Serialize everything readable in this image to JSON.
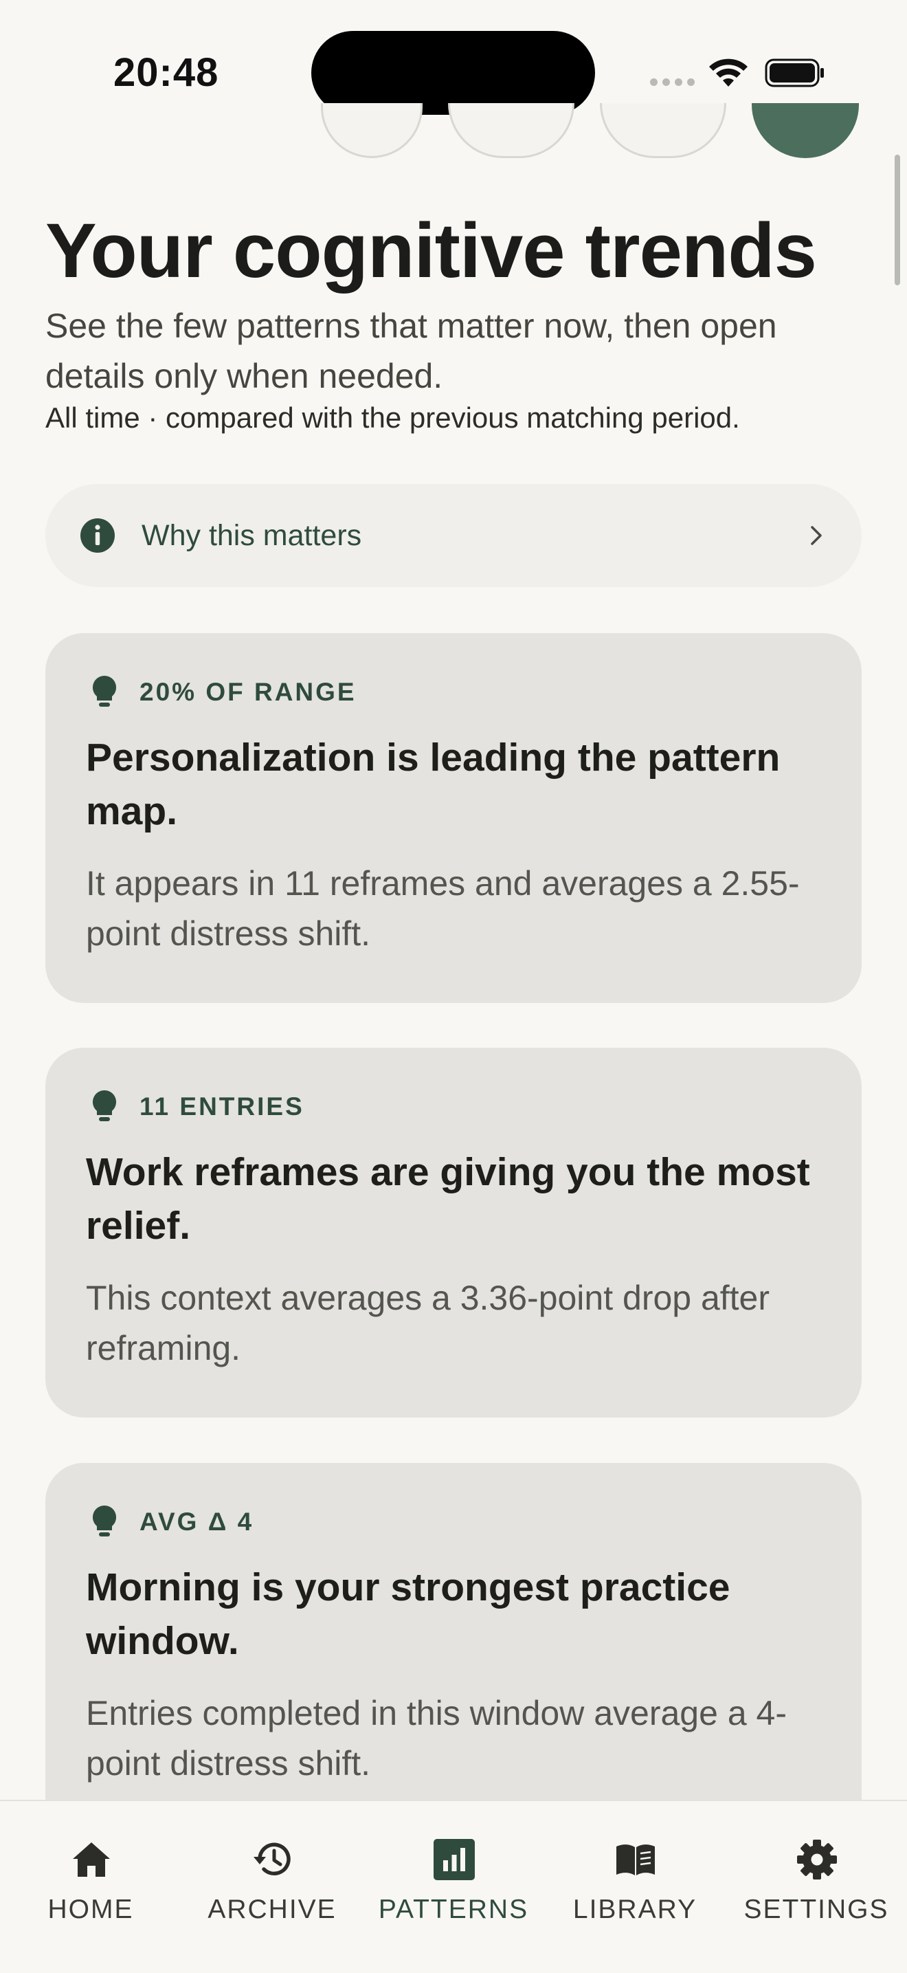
{
  "status_bar": {
    "time": "20:48",
    "signal_icon": "cellular-signal-icon",
    "wifi_icon": "wifi-icon",
    "battery_icon": "battery-icon"
  },
  "header": {
    "title": "Your cognitive trends",
    "subtitle": "See the few patterns that matter now, then open details only when needed.",
    "meta": "All time · compared with the previous matching period."
  },
  "why_row": {
    "icon": "info-icon",
    "label": "Why this matters",
    "chevron": "chevron-right-icon"
  },
  "insights": [
    {
      "icon": "lightbulb-icon",
      "tag": "20% OF RANGE",
      "headline": "Personalization is leading the pattern map.",
      "body": "It appears in 11 reframes and averages a 2.55-point distress shift."
    },
    {
      "icon": "lightbulb-icon",
      "tag": "11 ENTRIES",
      "headline": "Work reframes are giving you the most relief.",
      "body": "This context averages a 3.36-point drop after reframing."
    },
    {
      "icon": "lightbulb-icon",
      "tag": "AVG Δ 4",
      "headline": "Morning is your strongest practice window.",
      "body": "Entries completed in this window average a 4-point distress shift."
    }
  ],
  "tab_bar": {
    "active": "PATTERNS",
    "tabs": [
      {
        "label": "HOME",
        "icon": "home-icon"
      },
      {
        "label": "ARCHIVE",
        "icon": "history-icon"
      },
      {
        "label": "PATTERNS",
        "icon": "bar-chart-icon"
      },
      {
        "label": "LIBRARY",
        "icon": "book-icon"
      },
      {
        "label": "SETTINGS",
        "icon": "gear-icon"
      }
    ]
  },
  "colors": {
    "background": "#f8f7f4",
    "card": "#e4e3df",
    "accent": "#2f4b3e",
    "accent_fill": "#4b6f5c",
    "text": "#1c1c1a"
  }
}
